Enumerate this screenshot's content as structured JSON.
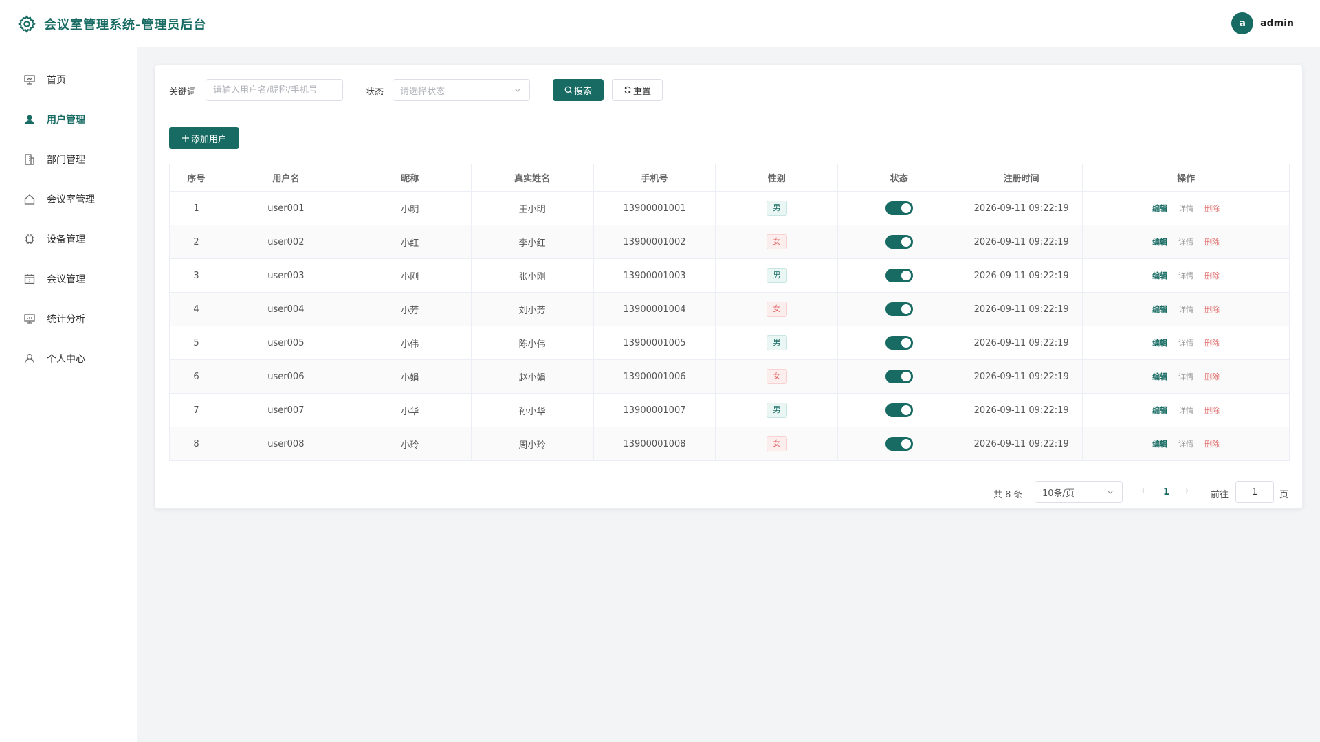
{
  "header": {
    "title": "会议室管理系统-管理员后台",
    "user": {
      "avatar_letter": "a",
      "name": "admin"
    },
    "accent_color": "#176b63"
  },
  "sidebar": {
    "items": [
      {
        "label": "首页",
        "icon": "presentation-icon",
        "active": false
      },
      {
        "label": "用户管理",
        "icon": "user-icon",
        "active": true
      },
      {
        "label": "部门管理",
        "icon": "building-icon",
        "active": false
      },
      {
        "label": "会议室管理",
        "icon": "home-icon",
        "active": false
      },
      {
        "label": "设备管理",
        "icon": "chip-icon",
        "active": false
      },
      {
        "label": "会议管理",
        "icon": "calendar-icon",
        "active": false
      },
      {
        "label": "统计分析",
        "icon": "chart-board-icon",
        "active": false
      },
      {
        "label": "个人中心",
        "icon": "person-outline-icon",
        "active": false
      }
    ]
  },
  "filters": {
    "keyword_label": "关键词",
    "keyword_placeholder": "请输入用户名/昵称/手机号",
    "keyword_value": "",
    "status_label": "状态",
    "status_placeholder": "请选择状态",
    "search_label": "搜索",
    "reset_label": "重置"
  },
  "toolbar": {
    "add_user_label": "添加用户"
  },
  "table": {
    "columns": [
      "序号",
      "用户名",
      "昵称",
      "真实姓名",
      "手机号",
      "性别",
      "状态",
      "注册时间",
      "操作"
    ],
    "actions": {
      "edit": "编辑",
      "detail": "详情",
      "delete": "删除"
    },
    "rows": [
      {
        "index": "1",
        "username": "user001",
        "nickname": "小明",
        "realname": "王小明",
        "phone": "13900001001",
        "gender": "男",
        "status_on": true,
        "registered": "2026-09-11 09:22:19"
      },
      {
        "index": "2",
        "username": "user002",
        "nickname": "小红",
        "realname": "李小红",
        "phone": "13900001002",
        "gender": "女",
        "status_on": true,
        "registered": "2026-09-11 09:22:19"
      },
      {
        "index": "3",
        "username": "user003",
        "nickname": "小刚",
        "realname": "张小刚",
        "phone": "13900001003",
        "gender": "男",
        "status_on": true,
        "registered": "2026-09-11 09:22:19"
      },
      {
        "index": "4",
        "username": "user004",
        "nickname": "小芳",
        "realname": "刘小芳",
        "phone": "13900001004",
        "gender": "女",
        "status_on": true,
        "registered": "2026-09-11 09:22:19"
      },
      {
        "index": "5",
        "username": "user005",
        "nickname": "小伟",
        "realname": "陈小伟",
        "phone": "13900001005",
        "gender": "男",
        "status_on": true,
        "registered": "2026-09-11 09:22:19"
      },
      {
        "index": "6",
        "username": "user006",
        "nickname": "小娟",
        "realname": "赵小娟",
        "phone": "13900001006",
        "gender": "女",
        "status_on": true,
        "registered": "2026-09-11 09:22:19"
      },
      {
        "index": "7",
        "username": "user007",
        "nickname": "小华",
        "realname": "孙小华",
        "phone": "13900001007",
        "gender": "男",
        "status_on": true,
        "registered": "2026-09-11 09:22:19"
      },
      {
        "index": "8",
        "username": "user008",
        "nickname": "小玲",
        "realname": "周小玲",
        "phone": "13900001008",
        "gender": "女",
        "status_on": true,
        "registered": "2026-09-11 09:22:19"
      }
    ]
  },
  "pagination": {
    "total_text": "共 8 条",
    "page_size": "10条/页",
    "current_page": "1",
    "goto_prefix": "前往",
    "goto_value": "1",
    "goto_suffix": "页"
  }
}
